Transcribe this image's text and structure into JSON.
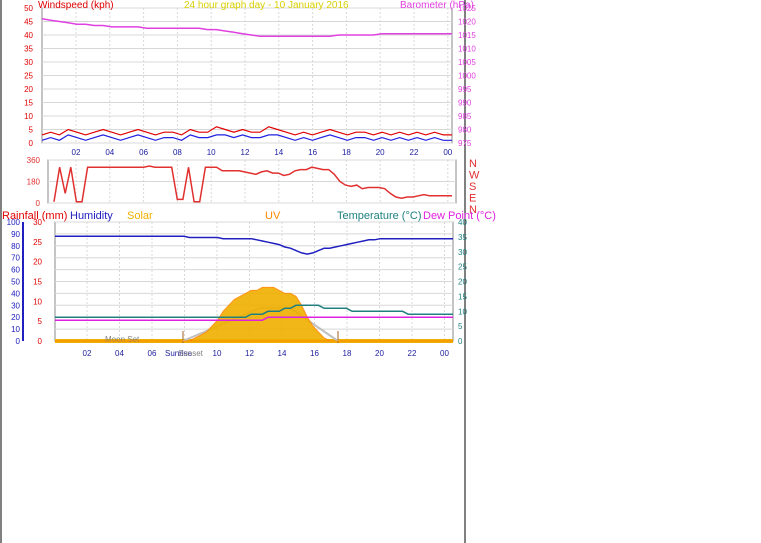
{
  "colors": {
    "wind": "#e00000",
    "gust": "#2020e0",
    "baro": "#e040e0",
    "dir": "#e03030",
    "humidity": "#2020c0",
    "temperature": "#208080",
    "dewpoint": "#e020e0",
    "solar": "#f0b000",
    "uv": "#ff8800",
    "rain": "#2020c0",
    "grid": "#d8d8d8",
    "axis": "#000000",
    "tick_blue": "#2020a0",
    "title": "#d8d000"
  },
  "chart_data": [
    {
      "type": "line",
      "title": "24 hour graph day - 10 January 2016",
      "left_label": "Windspeed (kph)",
      "right_label": "Barometer (hPa)",
      "x_ticks": [
        "02",
        "04",
        "06",
        "08",
        "10",
        "12",
        "14",
        "16",
        "18",
        "20",
        "22",
        "00"
      ],
      "y_left_ticks": [
        "0",
        "5",
        "10",
        "15",
        "20",
        "25",
        "30",
        "35",
        "40",
        "45",
        "50"
      ],
      "y_left_range": [
        0,
        50
      ],
      "y_right_ticks": [
        "975",
        "980",
        "985",
        "990",
        "995",
        "1000",
        "1005",
        "1010",
        "1015",
        "1020",
        "1025"
      ],
      "y_right_range": [
        975,
        1025
      ],
      "series": [
        {
          "key": "wind_avg",
          "values": [
            3,
            4,
            3,
            5,
            4,
            3,
            4,
            5,
            4,
            3,
            4,
            5,
            4,
            3,
            4,
            4,
            3,
            5,
            4,
            4,
            6,
            5,
            4,
            5,
            4,
            4,
            6,
            5,
            4,
            3,
            4,
            3,
            4,
            5,
            4,
            3,
            4,
            4,
            3,
            4,
            3,
            4,
            3,
            4,
            3,
            4,
            3,
            3
          ]
        },
        {
          "key": "wind_gust",
          "values": [
            1,
            2,
            1,
            3,
            2,
            1,
            2,
            3,
            2,
            1,
            2,
            3,
            2,
            1,
            2,
            2,
            1,
            3,
            2,
            2,
            3,
            3,
            2,
            3,
            2,
            2,
            3,
            3,
            2,
            1,
            2,
            1,
            2,
            3,
            2,
            1,
            2,
            2,
            1,
            2,
            1,
            2,
            1,
            2,
            1,
            2,
            1,
            1
          ]
        },
        {
          "key": "barometer",
          "values": [
            1021,
            1020.5,
            1020,
            1019.5,
            1019,
            1019,
            1018.5,
            1018.5,
            1018,
            1018,
            1018,
            1018,
            1017.5,
            1017.5,
            1017.5,
            1017.5,
            1017.5,
            1017.5,
            1017.5,
            1017,
            1017,
            1016.5,
            1016,
            1015.5,
            1015,
            1014.5,
            1014.5,
            1014.5,
            1014.5,
            1014.5,
            1014.5,
            1014.5,
            1014.5,
            1014.5,
            1015,
            1015,
            1015,
            1015,
            1015,
            1015.5,
            1015.5,
            1015.5,
            1015.5,
            1015.5,
            1015.5,
            1015.5,
            1015.5,
            1015.5
          ]
        }
      ]
    },
    {
      "type": "line",
      "y_left_ticks": [
        "0",
        "180",
        "360"
      ],
      "y_left_range": [
        0,
        360
      ],
      "y_right_labels": [
        "N",
        "W",
        "S",
        "E",
        "N"
      ],
      "series": [
        {
          "key": "wind_direction",
          "values": [
            10,
            300,
            80,
            300,
            10,
            10,
            300,
            300,
            300,
            300,
            300,
            300,
            300,
            300,
            300,
            300,
            300,
            310,
            300,
            300,
            300,
            300,
            30,
            30,
            300,
            10,
            10,
            300,
            300,
            300,
            270,
            270,
            270,
            270,
            260,
            250,
            240,
            260,
            270,
            250,
            250,
            230,
            240,
            270,
            280,
            280,
            300,
            290,
            280,
            280,
            240,
            180,
            150,
            140,
            150,
            120,
            130,
            130,
            130,
            120,
            80,
            50,
            40,
            50,
            50,
            60,
            70,
            60,
            60,
            60,
            60,
            60
          ]
        }
      ]
    },
    {
      "type": "line",
      "labels": [
        "Rainfall (mm)",
        "Humidity",
        "Solar",
        "UV",
        "Temperature (°C)",
        "Dew Point (°C)"
      ],
      "x_ticks": [
        "02",
        "04",
        "06",
        "08",
        "10",
        "12",
        "14",
        "16",
        "18",
        "20",
        "22",
        "00"
      ],
      "y_humidity_ticks": [
        "0",
        "10",
        "20",
        "30",
        "40",
        "50",
        "60",
        "70",
        "80",
        "90",
        "100"
      ],
      "y_rain_ticks": [
        "0",
        "5",
        "10",
        "15",
        "20",
        "25",
        "30"
      ],
      "y_temp_ticks": [
        "0",
        "5",
        "10",
        "15",
        "20",
        "25",
        "30",
        "35",
        "40"
      ],
      "annotations": {
        "moon": "Moon Set",
        "sun_rise": "Sunrise",
        "sun_set": "Sunset"
      },
      "series": [
        {
          "key": "humidity",
          "values": [
            88,
            88,
            88,
            88,
            88,
            88,
            88,
            88,
            88,
            88,
            88,
            88,
            88,
            88,
            88,
            88,
            88,
            88,
            88,
            88,
            88,
            88,
            88,
            88,
            87,
            87,
            87,
            87,
            87,
            87,
            86,
            86,
            86,
            86,
            86,
            86,
            85,
            84,
            83,
            82,
            81,
            79,
            78,
            76,
            74,
            73,
            74,
            76,
            78,
            78,
            79,
            80,
            81,
            82,
            83,
            84,
            85,
            85,
            86,
            86,
            86,
            86,
            86,
            86,
            86,
            86,
            86,
            86,
            86,
            86,
            86,
            86
          ]
        },
        {
          "key": "temperature",
          "values": [
            8,
            8,
            8,
            8,
            8,
            8,
            8,
            8,
            8,
            8,
            8,
            8,
            8,
            8,
            8,
            8,
            8,
            8,
            8,
            8,
            8,
            8,
            8,
            8,
            8,
            8,
            8,
            8,
            8,
            8,
            8,
            8,
            8,
            8,
            8,
            9,
            9,
            9,
            10,
            10,
            10,
            11,
            11,
            12,
            12,
            12,
            12,
            12,
            11,
            11,
            11,
            11,
            11,
            10,
            10,
            10,
            10,
            10,
            10,
            10,
            10,
            10,
            10,
            9,
            9,
            9,
            9,
            9,
            9,
            9,
            9,
            9
          ]
        },
        {
          "key": "dewpoint",
          "values": [
            7,
            7,
            7,
            7,
            7,
            7,
            7,
            7,
            7,
            7,
            7,
            7,
            7,
            7,
            7,
            7,
            7,
            7,
            7,
            7,
            7,
            7,
            7,
            7,
            7,
            7,
            7,
            7,
            7,
            7,
            7,
            7,
            7,
            7,
            7,
            7,
            7,
            7,
            8,
            8,
            8,
            8,
            8,
            8,
            8,
            8,
            8,
            8,
            8,
            8,
            8,
            8,
            8,
            8,
            8,
            8,
            8,
            8,
            8,
            8,
            8,
            8,
            8,
            8,
            8,
            8,
            8,
            8,
            8,
            8,
            8,
            8
          ]
        },
        {
          "key": "solar",
          "values": [
            0,
            0,
            0,
            0,
            0,
            0,
            0,
            0,
            0,
            0,
            0,
            0,
            0,
            0,
            0,
            0,
            0,
            0,
            0,
            0,
            0,
            0,
            0,
            0,
            0,
            1,
            2,
            3,
            5,
            7,
            10,
            12,
            14,
            15,
            16,
            17,
            17,
            18,
            18,
            18,
            17,
            16,
            16,
            15,
            12,
            8,
            5,
            3,
            1,
            0,
            0,
            0,
            0,
            0,
            0,
            0,
            0,
            0,
            0,
            0,
            0,
            0,
            0,
            0,
            0,
            0,
            0,
            0,
            0,
            0,
            0,
            0
          ]
        }
      ]
    }
  ]
}
